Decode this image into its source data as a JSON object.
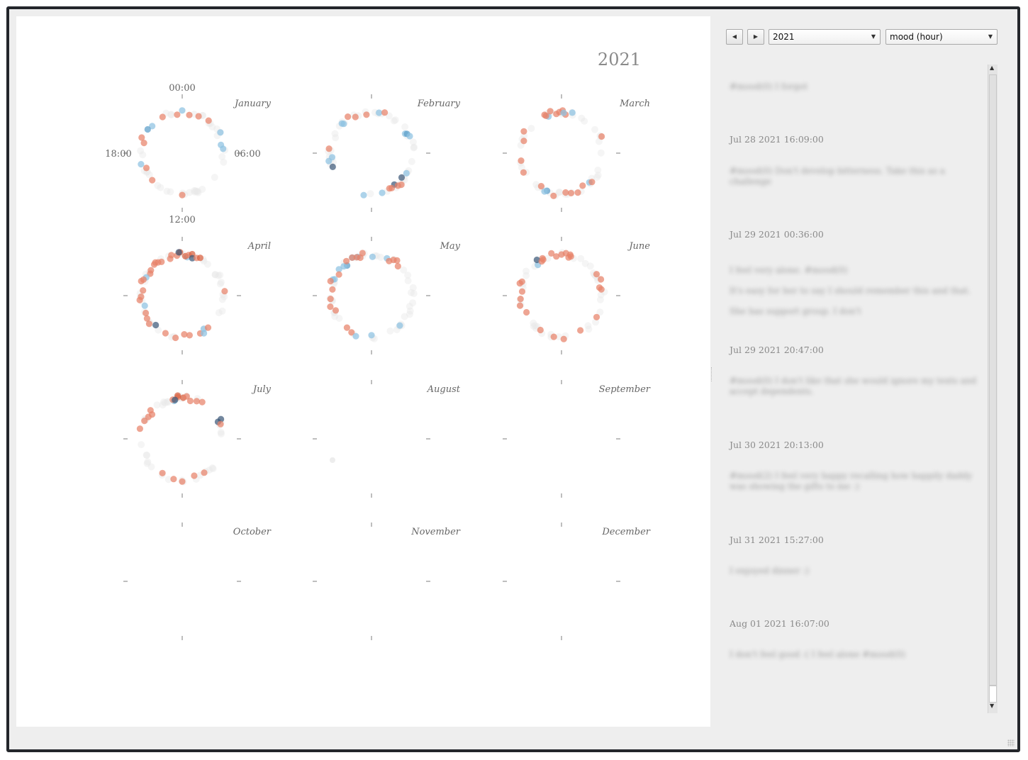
{
  "chart_data": {
    "type": "scatter",
    "subtype": "polar clock per month",
    "title": "2021",
    "clock_labels": {
      "top": "00:00",
      "right": "06:00",
      "bottom": "12:00",
      "left": "18:00"
    },
    "months": [
      {
        "name": "January",
        "points": [
          [
            23.5,
            "pos"
          ],
          [
            20.8,
            "neg"
          ],
          [
            20.3,
            "neg2"
          ],
          [
            19.4,
            "pos"
          ],
          [
            19.0,
            "pos"
          ],
          [
            22.1,
            "pos"
          ],
          [
            0.0,
            "neg"
          ],
          [
            0.7,
            "pos"
          ],
          [
            1.6,
            "pos"
          ],
          [
            2.6,
            "pos"
          ],
          [
            4.1,
            "neg"
          ],
          [
            5.2,
            "neg"
          ],
          [
            5.6,
            "neg"
          ],
          [
            17.0,
            "neg"
          ],
          [
            16.5,
            "pos"
          ],
          [
            15.2,
            "pos"
          ],
          [
            12.0,
            "pos"
          ]
        ]
      },
      {
        "name": "February",
        "points": [
          [
            23.5,
            "pos"
          ],
          [
            21.1,
            "neg"
          ],
          [
            21.0,
            "neg"
          ],
          [
            21.8,
            "pos"
          ],
          [
            22.4,
            "pos"
          ],
          [
            0.7,
            "neg"
          ],
          [
            1.2,
            "pos"
          ],
          [
            4.0,
            "neg"
          ],
          [
            4.1,
            "neg2"
          ],
          [
            4.4,
            "neg"
          ],
          [
            17.3,
            "neg"
          ],
          [
            17.6,
            "neg"
          ],
          [
            16.7,
            "neg3"
          ],
          [
            18.4,
            "pos"
          ],
          [
            9.6,
            "neg3"
          ],
          [
            10.0,
            "pos"
          ],
          [
            9.4,
            "pos"
          ],
          [
            9.1,
            "pos"
          ],
          [
            10.2,
            "pos"
          ],
          [
            11.0,
            "neg"
          ],
          [
            12.7,
            "neg"
          ],
          [
            8.6,
            "neg3"
          ],
          [
            8.0,
            "neg"
          ]
        ]
      },
      {
        "name": "March",
        "points": [
          [
            22.7,
            "neg"
          ],
          [
            22.5,
            "pos"
          ],
          [
            22.4,
            "pos"
          ],
          [
            23.0,
            "pos"
          ],
          [
            23.5,
            "pos"
          ],
          [
            23.8,
            "pos"
          ],
          [
            0.1,
            "pos"
          ],
          [
            0.4,
            "pos"
          ],
          [
            0.2,
            "neg"
          ],
          [
            1.0,
            "neg"
          ],
          [
            20.0,
            "pos"
          ],
          [
            19.2,
            "pos"
          ],
          [
            17.3,
            "pos"
          ],
          [
            16.2,
            "pos"
          ],
          [
            14.1,
            "pos"
          ],
          [
            13.4,
            "neg2"
          ],
          [
            13.6,
            "neg"
          ],
          [
            12.7,
            "pos"
          ],
          [
            11.6,
            "pos"
          ],
          [
            11.1,
            "pos"
          ],
          [
            10.5,
            "pos"
          ],
          [
            9.8,
            "pos"
          ],
          [
            9.1,
            "neg"
          ],
          [
            8.9,
            "pos"
          ],
          [
            4.5,
            "pos"
          ]
        ]
      },
      {
        "name": "April",
        "points": [
          [
            0.5,
            "neg"
          ],
          [
            23.5,
            "pos"
          ],
          [
            23.0,
            "pos"
          ],
          [
            23.8,
            "pos2"
          ],
          [
            0.3,
            "pos2"
          ],
          [
            0.6,
            "pos"
          ],
          [
            0.9,
            "pos2"
          ],
          [
            1.0,
            "neg3"
          ],
          [
            1.4,
            "pos"
          ],
          [
            1.7,
            "pos2"
          ],
          [
            23.7,
            "neg3"
          ],
          [
            21.9,
            "pos"
          ],
          [
            21.6,
            "pos"
          ],
          [
            21.4,
            "pos"
          ],
          [
            20.3,
            "pos"
          ],
          [
            19.8,
            "neg"
          ],
          [
            19.5,
            "pos"
          ],
          [
            19.3,
            "pos"
          ],
          [
            18.5,
            "pos"
          ],
          [
            17.9,
            "pos"
          ],
          [
            17.6,
            "pos"
          ],
          [
            17.0,
            "neg"
          ],
          [
            16.3,
            "pos"
          ],
          [
            15.8,
            "pos"
          ],
          [
            15.3,
            "pos"
          ],
          [
            14.8,
            "neg3"
          ],
          [
            13.6,
            "pos"
          ],
          [
            12.6,
            "pos"
          ],
          [
            11.8,
            "pos"
          ],
          [
            11.3,
            "pos"
          ],
          [
            10.3,
            "pos"
          ],
          [
            10.0,
            "neg"
          ],
          [
            9.8,
            "neg"
          ],
          [
            9.4,
            "pos"
          ],
          [
            5.6,
            "pos"
          ],
          [
            22.8,
            "pos"
          ],
          [
            20.6,
            "pos"
          ],
          [
            21.2,
            "pos"
          ]
        ]
      },
      {
        "name": "May",
        "points": [
          [
            0.1,
            "neg"
          ],
          [
            1.5,
            "neg"
          ],
          [
            2.1,
            "pos"
          ],
          [
            2.4,
            "pos"
          ],
          [
            2.8,
            "pos"
          ],
          [
            22.7,
            "neg"
          ],
          [
            22.2,
            "neg"
          ],
          [
            21.4,
            "neg2"
          ],
          [
            21.1,
            "neg"
          ],
          [
            20.6,
            "neg"
          ],
          [
            23.2,
            "pos"
          ],
          [
            22.9,
            "pos"
          ],
          [
            22.6,
            "pos"
          ],
          [
            21.6,
            "pos"
          ],
          [
            20.2,
            "pos"
          ],
          [
            19.6,
            "neg"
          ],
          [
            19.5,
            "neg"
          ],
          [
            19.3,
            "pos"
          ],
          [
            18.6,
            "pos"
          ],
          [
            17.7,
            "pos"
          ],
          [
            17.0,
            "pos"
          ],
          [
            16.5,
            "pos"
          ],
          [
            14.5,
            "pos"
          ],
          [
            13.9,
            "pos"
          ],
          [
            13.4,
            "neg"
          ],
          [
            12.0,
            "neg"
          ],
          [
            9.1,
            "neg"
          ],
          [
            22.2,
            "pos"
          ],
          [
            1.8,
            "pos"
          ]
        ]
      },
      {
        "name": "June",
        "points": [
          [
            21.5,
            "neg"
          ],
          [
            22.2,
            "pos"
          ],
          [
            22.2,
            "pos"
          ],
          [
            21.7,
            "neg3"
          ],
          [
            22.0,
            "pos"
          ],
          [
            0.0,
            "pos"
          ],
          [
            0.4,
            "pos"
          ],
          [
            0.7,
            "pos"
          ],
          [
            0.9,
            "pos"
          ],
          [
            0.8,
            "pos"
          ],
          [
            23.1,
            "pos"
          ],
          [
            23.5,
            "pos"
          ],
          [
            3.9,
            "pos"
          ],
          [
            4.5,
            "pos"
          ],
          [
            5.2,
            "pos"
          ],
          [
            5.4,
            "pos"
          ],
          [
            19.3,
            "pos"
          ],
          [
            19.1,
            "pos"
          ],
          [
            18.4,
            "pos"
          ],
          [
            17.7,
            "pos"
          ],
          [
            17.1,
            "pos"
          ],
          [
            16.3,
            "pos"
          ],
          [
            14.1,
            "pos"
          ],
          [
            12.7,
            "pos"
          ],
          [
            11.8,
            "pos"
          ],
          [
            10.1,
            "pos"
          ],
          [
            8.1,
            "pos"
          ]
        ]
      },
      {
        "name": "July",
        "points": [
          [
            23.2,
            "neg"
          ],
          [
            23.1,
            "pos"
          ],
          [
            23.6,
            "pos"
          ],
          [
            23.6,
            "pos2"
          ],
          [
            23.3,
            "neg3"
          ],
          [
            0.1,
            "pos2"
          ],
          [
            0.4,
            "pos"
          ],
          [
            0.8,
            "pos"
          ],
          [
            1.4,
            "pos"
          ],
          [
            1.9,
            "pos"
          ],
          [
            4.2,
            "neg3"
          ],
          [
            4.3,
            "neg3"
          ],
          [
            4.6,
            "pos"
          ],
          [
            20.8,
            "pos"
          ],
          [
            20.6,
            "pos"
          ],
          [
            20.2,
            "pos"
          ],
          [
            19.7,
            "pos"
          ],
          [
            18.9,
            "pos"
          ],
          [
            14.0,
            "pos"
          ],
          [
            12.8,
            "pos"
          ],
          [
            12.0,
            "pos"
          ],
          [
            10.8,
            "pos"
          ],
          [
            9.8,
            "pos"
          ]
        ]
      },
      {
        "name": "August",
        "points": []
      },
      {
        "name": "September",
        "points": []
      },
      {
        "name": "October",
        "points": []
      },
      {
        "name": "November",
        "points": []
      },
      {
        "name": "December",
        "points": []
      }
    ],
    "radial_axis": "hour of day",
    "color_scale": {
      "pos": "#e8826a",
      "pos2": "#d9603f",
      "neg": "#8ec2e2",
      "neg2": "#5b9ec9",
      "neg3": "#3f5a7a",
      "neg4": "#7a2f3d",
      "neutral": "#e8e8e8"
    },
    "grid": false
  },
  "toolbar": {
    "prev_icon": "◀",
    "next_icon": "▶",
    "year_value": "2021",
    "metric_value": "mood (hour)",
    "dropdown_arrow": "▼"
  },
  "feed": {
    "entries": [
      {
        "time": "",
        "text": "#mood(0) I forgot"
      },
      {
        "time": "Jul 28 2021 16:09:00",
        "text": "#mood(0) Don't develop bitterness. Take this as a challenge"
      },
      {
        "time": "Jul 29 2021 00:36:00",
        "text": "I feel very alone. #mood(0)\nIt's easy for her to say I should remember this and that. She has support group. I don't"
      },
      {
        "time": "Jul 29 2021 20:47:00",
        "text": "#mood(0) I don't like that she would ignore my texts and accept dependents."
      },
      {
        "time": "Jul 30 2021 20:13:00",
        "text": "#mood(2) I feel very happy recalling how happily daddy was showing the gifts to me :)"
      },
      {
        "time": "Jul 31 2021 15:27:00",
        "text": "I enjoyed dinner :)"
      },
      {
        "time": "Aug 01 2021 16:07:00",
        "text": "I don't feel good :( I feel alone #mood(0)"
      }
    ]
  },
  "scroll": {
    "up_icon": "▲",
    "down_icon": "▼"
  }
}
